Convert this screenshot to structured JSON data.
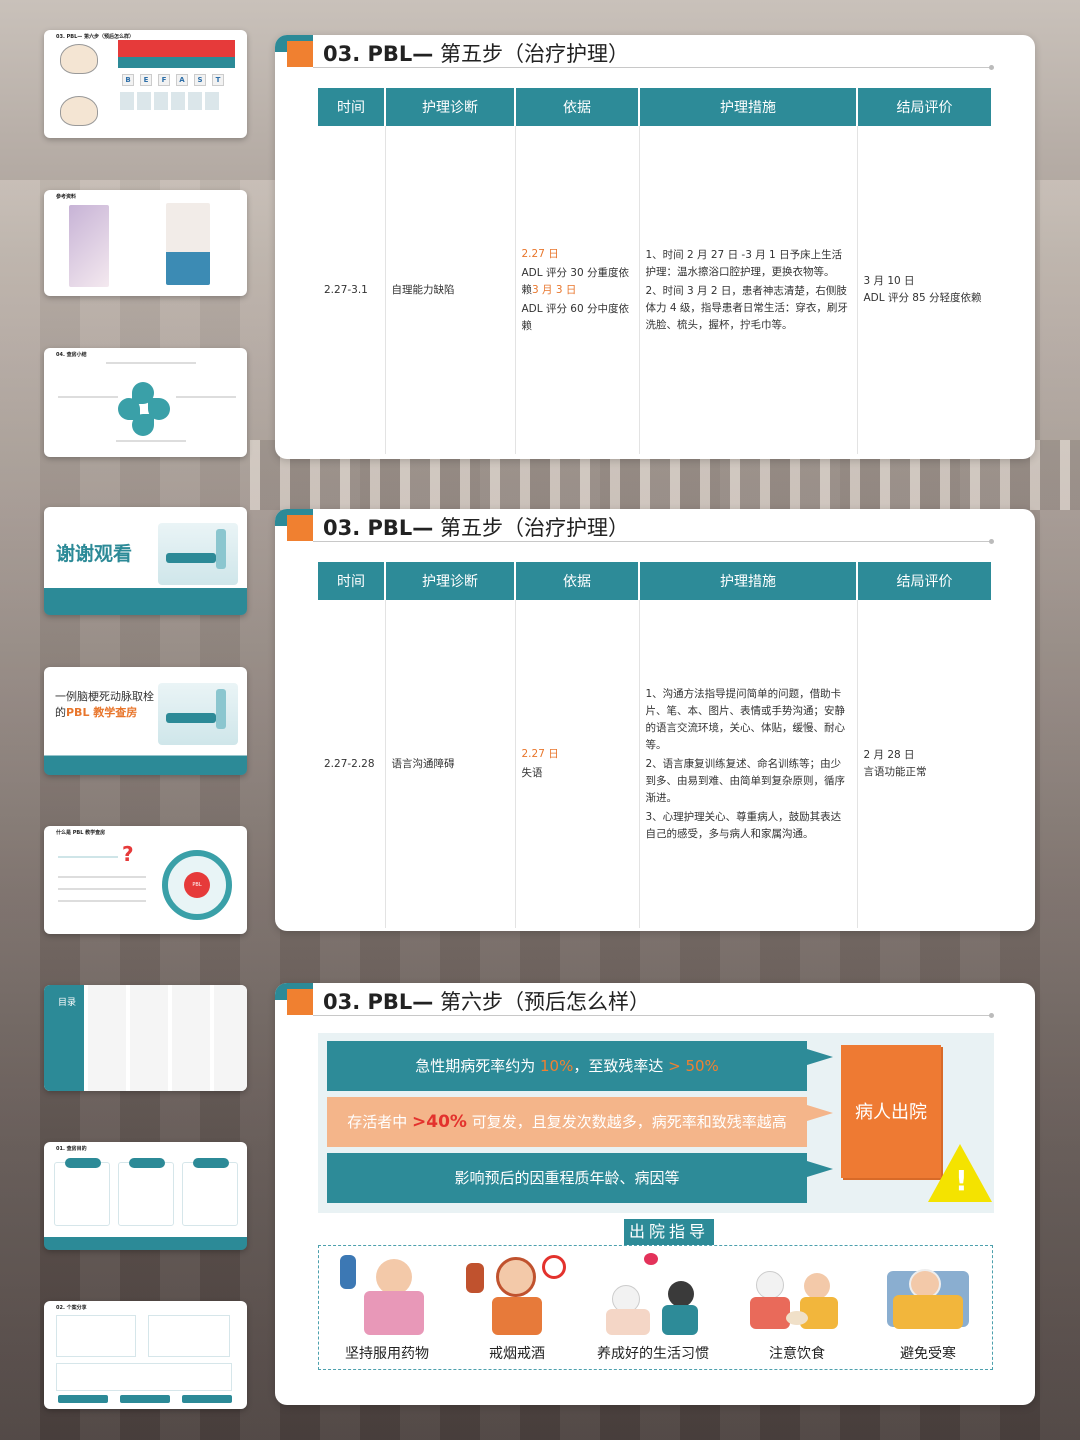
{
  "colors": {
    "teal": "#2d8b98",
    "orange": "#f08030",
    "peach": "#f4b58a",
    "red": "#e3322d",
    "yellow": "#f4e300"
  },
  "thumbnails": [
    {
      "title": "03. PBL— 第六步（预后怎么样）",
      "icon": "befast-slide"
    },
    {
      "title": "参考资料",
      "icon": "books-slide"
    },
    {
      "title": "04. 查房小结",
      "icon": "summary-slide"
    },
    {
      "title": "谢谢观看",
      "icon": "thanks-slide"
    },
    {
      "title": "一例脑梗死动脉取栓的",
      "title_highlight": "PBL 教学查房",
      "icon": "cover-slide"
    },
    {
      "title": "什么是 PBL 教学查房",
      "icon": "pbl-intro-slide"
    },
    {
      "title": "目录",
      "icon": "contents-slide"
    },
    {
      "title": "01. 查房目的",
      "icon": "purpose-slide"
    },
    {
      "title": "02. 个案分享",
      "icon": "case-slide"
    }
  ],
  "thumb_extras": {
    "befast_letters": [
      "B",
      "E",
      "F",
      "A",
      "S",
      "T"
    ],
    "contents_label": "目录"
  },
  "slide1": {
    "title_prefix": "03. PBL—",
    "title_rest": " 第五步（治疗护理）",
    "headers": [
      "时间",
      "护理诊断",
      "依据",
      "护理措施",
      "结局评价"
    ],
    "row": {
      "time": "2.27-3.1",
      "diagnosis": "自理能力缺陷",
      "basis_date": "2.27 日",
      "basis_line1": "ADL 评分 30 分重度依赖",
      "basis_date2": "3 月 3 日",
      "basis_line2": "ADL 评分 60 分中度依赖",
      "measure1": "1、时间 2 月 27 日 -3 月 1 日予床上生活护理：温水擦浴口腔护理，更换衣物等。",
      "measure2": "2、时间 3 月 2 日，患者神志清楚，右侧肢体力 4 级，指导患者日常生活：穿衣，刷牙洗脸、梳头，握杯，拧毛巾等。",
      "outcome_date": "3 月 10 日",
      "outcome": "ADL 评分 85 分轻度依赖"
    }
  },
  "slide2": {
    "title_prefix": "03. PBL—",
    "title_rest": " 第五步（治疗护理）",
    "headers": [
      "时间",
      "护理诊断",
      "依据",
      "护理措施",
      "结局评价"
    ],
    "row": {
      "time": "2.27-2.28",
      "diagnosis": "语言沟通障碍",
      "basis_date": "2.27 日",
      "basis_line1": "失语",
      "measure1": "1、沟通方法指导提问简单的问题，借助卡片、笔、本、图片、表情或手势沟通；安静的语言交流环境，关心、体贴，缓慢、耐心等。",
      "measure2": "2、语言康复训练复述、命名训练等；由少到多、由易到难、由简单到复杂原则，循序渐进。",
      "measure3": "3、心理护理关心、尊重病人，鼓励其表达自己的感受，多与病人和家属沟通。",
      "outcome_date": "2 月 28 日",
      "outcome": "言语功能正常"
    }
  },
  "slide3": {
    "title_prefix": "03. PBL—",
    "title_rest": " 第六步（预后怎么样）",
    "prognosis": {
      "line1_pre": "急性期病死率约为 ",
      "line1_hl1": "10%",
      "line1_mid": "，至致残率达 ",
      "line1_hl2": "> 50%",
      "line2_pre": "存活者中 ",
      "line2_hl": ">40%",
      "line2_post": " 可复发，且复发次数越多，病死率和致残率越高",
      "line3": "影响预后的因重程质年龄、病因等"
    },
    "discharge_label": "病人出院",
    "warning_mark": "!",
    "guide_title": "出院指导",
    "guide_items": [
      {
        "label": "坚持服用药物",
        "icon": "medicine-icon"
      },
      {
        "label": "戒烟戒酒",
        "icon": "no-smoking-icon"
      },
      {
        "label": "养成好的生活习惯",
        "icon": "lifestyle-icon"
      },
      {
        "label": "注意饮食",
        "icon": "diet-icon"
      },
      {
        "label": "避免受寒",
        "icon": "warm-blanket-icon"
      }
    ]
  }
}
